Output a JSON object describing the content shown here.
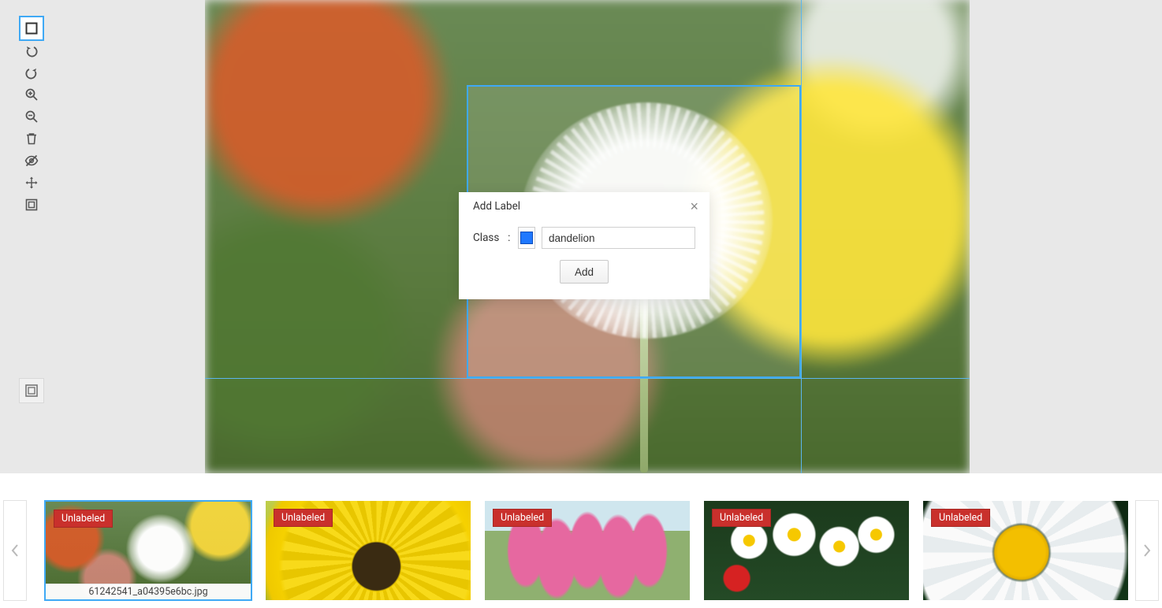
{
  "dialog": {
    "title": "Add Label",
    "class_label": "Class",
    "input_value": "dandelion",
    "add_button": "Add",
    "swatch_color": "#1f78ff"
  },
  "badge_label": "Unlabeled",
  "thumbnails": [
    {
      "filename": "61242541_a04395e6bc.jpg",
      "labeled": false,
      "selected": true
    },
    {
      "filename": "",
      "labeled": false,
      "selected": false
    },
    {
      "filename": "",
      "labeled": false,
      "selected": false
    },
    {
      "filename": "",
      "labeled": false,
      "selected": false
    },
    {
      "filename": "",
      "labeled": false,
      "selected": false
    }
  ]
}
